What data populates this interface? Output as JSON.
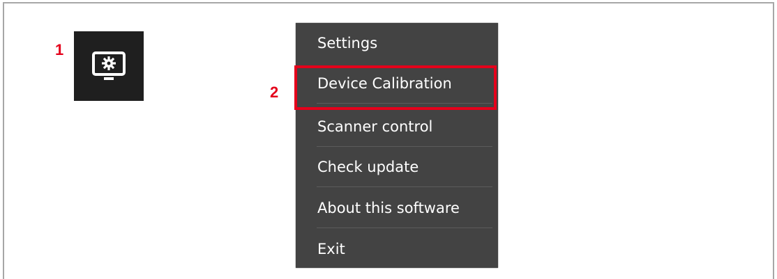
{
  "annotations": {
    "step1": "1",
    "step2": "2"
  },
  "tray_icon": {
    "icon": "monitor-gear-icon"
  },
  "context_menu": {
    "items": [
      {
        "label": "Settings"
      },
      {
        "label": "Device Calibration"
      },
      {
        "label": "Scanner control"
      },
      {
        "label": "Check update"
      },
      {
        "label": "About this software"
      },
      {
        "label": "Exit"
      }
    ]
  },
  "colors": {
    "annotation_red": "#e4001b",
    "menu_bg": "#434343",
    "tray_bg": "#1f1f1f"
  }
}
